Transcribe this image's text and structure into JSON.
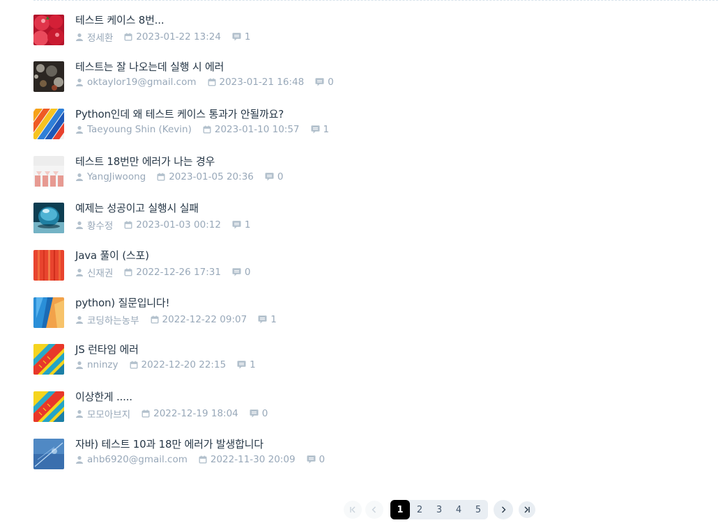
{
  "posts": [
    {
      "title": "테스트 케이스 8번...",
      "author": "정세환",
      "date": "2023-01-22 13:24",
      "comments": "1",
      "thumb": "tomatoes"
    },
    {
      "title": "테스트는 잘 나오는데 실행 시 에러",
      "author": "oktaylor19@gmail.com",
      "date": "2023-01-21 16:48",
      "comments": "0",
      "thumb": "bokeh"
    },
    {
      "title": "Python인데 왜 테스트 케이스 통과가 안될까요?",
      "author": "Taeyoung Shin (Kevin)",
      "date": "2023-01-10 10:57",
      "comments": "1",
      "thumb": "pencils"
    },
    {
      "title": "테스트 18번만 에러가 나는 경우",
      "author": "YangJiwoong",
      "date": "2023-01-05 20:36",
      "comments": "0",
      "thumb": "pattern"
    },
    {
      "title": "예제는 성공이고 실행시 실패",
      "author": "황수정",
      "date": "2023-01-03 00:12",
      "comments": "1",
      "thumb": "sphere"
    },
    {
      "title": "Java 풀이 (스포)",
      "author": "신재권",
      "date": "2022-12-26 17:31",
      "comments": "0",
      "thumb": "red-lines"
    },
    {
      "title": "python) 질문입니다!",
      "author": "코딩하는농부",
      "date": "2022-12-22 09:07",
      "comments": "1",
      "thumb": "paint"
    },
    {
      "title": "JS 런타임 에러",
      "author": "nninzy",
      "date": "2022-12-20 22:15",
      "comments": "1",
      "thumb": "colorful-rails"
    },
    {
      "title": "이상한게 .....",
      "author": "모모아브지",
      "date": "2022-12-19 18:04",
      "comments": "0",
      "thumb": "colorful-rails"
    },
    {
      "title": "자바) 테스트 10과 18만 에러가 발생합니다",
      "author": "ahb6920@gmail.com",
      "date": "2022-11-30 20:09",
      "comments": "0",
      "thumb": "blue-sky"
    }
  ],
  "pagination": {
    "pages": [
      "1",
      "2",
      "3",
      "4",
      "5"
    ],
    "current": "1",
    "icons": [
      "first-page-icon",
      "previous-page-icon",
      "next-page-icon",
      "last-page-icon"
    ]
  },
  "colors": {
    "title": "#263747",
    "meta": "#98a8b9",
    "meta_icon": "#b2c0cc",
    "page_active_bg": "#000000",
    "page_group_bg": "#e9eef3"
  },
  "icons": {
    "author": "user-icon",
    "date": "calendar-icon",
    "comments": "comment-icon"
  }
}
